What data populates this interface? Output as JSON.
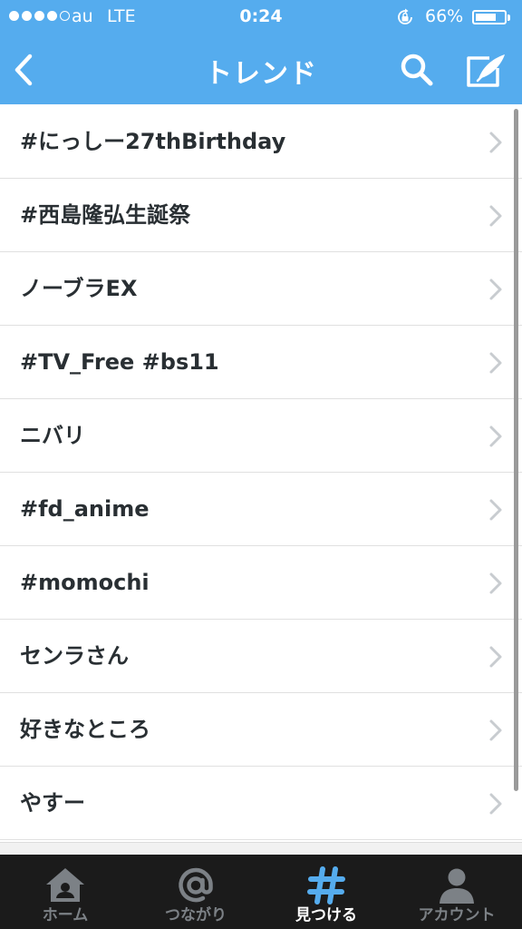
{
  "status_bar": {
    "carrier": "au",
    "network": "LTE",
    "time": "0:24",
    "battery_percent": "66%",
    "signal_bars_filled": 4,
    "signal_bars_total": 5,
    "battery_level": 0.66
  },
  "nav": {
    "title": "トレンド",
    "back_icon": "chevron-left-icon",
    "search_icon": "search-icon",
    "compose_icon": "compose-icon"
  },
  "trends": [
    "#にっしー27thBirthday",
    "#西島隆弘生誕祭",
    "ノーブラEX",
    "#TV_Free #bs11",
    "ニバリ",
    "#fd_anime",
    "#momochi",
    "センラさん",
    "好きなところ",
    "やすー"
  ],
  "tabs": [
    {
      "label": "ホーム",
      "icon": "home-icon",
      "active": false
    },
    {
      "label": "つながり",
      "icon": "at-icon",
      "active": false
    },
    {
      "label": "見つける",
      "icon": "hashtag-icon",
      "active": true
    },
    {
      "label": "アカウント",
      "icon": "person-icon",
      "active": false
    }
  ],
  "colors": {
    "header_bg": "#55acee",
    "tab_bar_bg": "#1b1b1b",
    "active_tab": "#55acee",
    "inactive_tab": "#7c8186",
    "text": "#292f33"
  }
}
